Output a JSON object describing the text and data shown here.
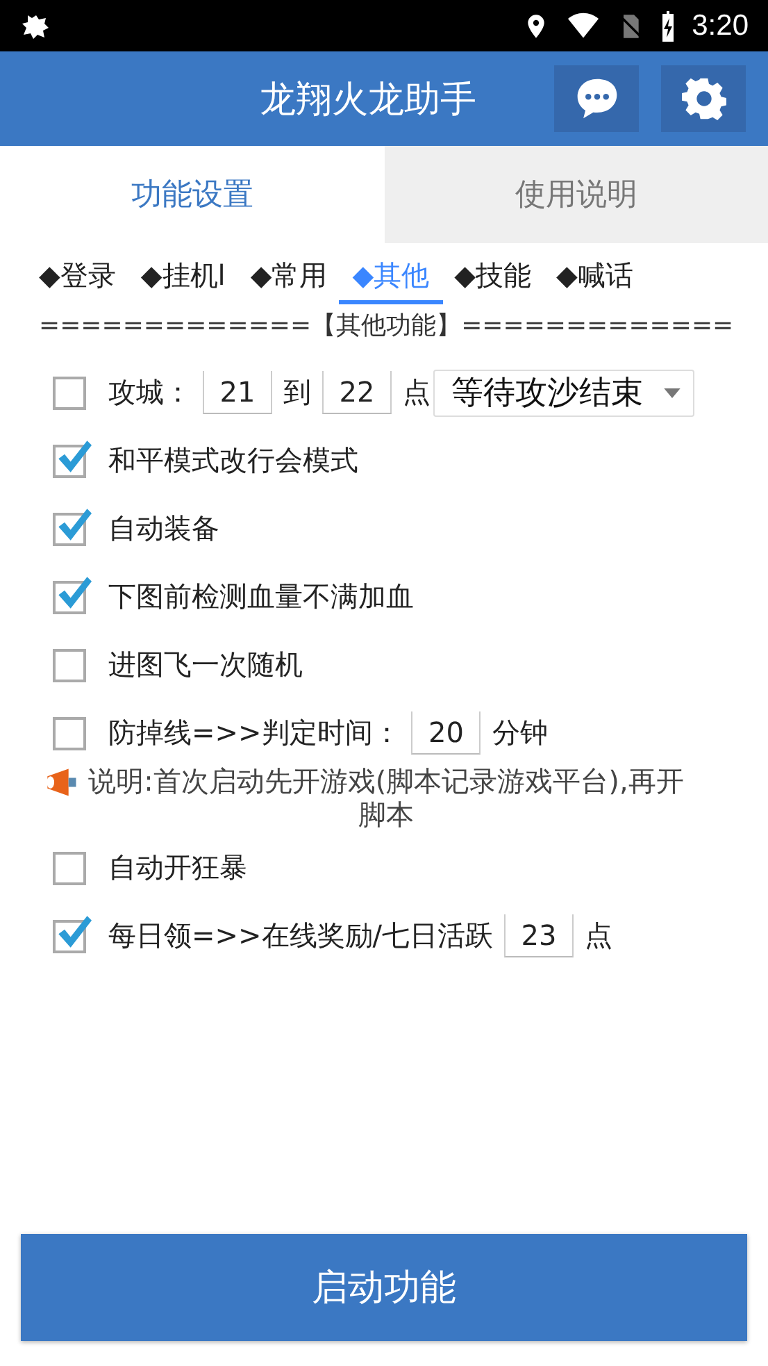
{
  "status_bar": {
    "time": "3:20"
  },
  "header": {
    "title": "龙翔火龙助手"
  },
  "tabs": [
    {
      "label": "功能设置",
      "selected": true
    },
    {
      "label": "使用说明",
      "selected": false
    }
  ],
  "sub_tabs": [
    {
      "label": "◆登录",
      "selected": false
    },
    {
      "label": "◆挂机l",
      "selected": false
    },
    {
      "label": "◆常用",
      "selected": false
    },
    {
      "label": "◆其他",
      "selected": true
    },
    {
      "label": "◆技能",
      "selected": false
    },
    {
      "label": "◆喊话",
      "selected": false
    }
  ],
  "section_title": "=============【其他功能】=============",
  "options": [
    {
      "kind": "check",
      "checked": false,
      "parts": [
        {
          "kind": "text",
          "text": "攻城："
        },
        {
          "kind": "input",
          "value": "21"
        },
        {
          "kind": "text",
          "text": "到"
        },
        {
          "kind": "input",
          "value": "22"
        },
        {
          "kind": "text",
          "text": "点"
        },
        {
          "kind": "dropdown",
          "value": "等待攻沙结束"
        }
      ]
    },
    {
      "kind": "check",
      "checked": true,
      "parts": [
        {
          "kind": "text",
          "text": "和平模式改行会模式"
        }
      ]
    },
    {
      "kind": "check",
      "checked": true,
      "parts": [
        {
          "kind": "text",
          "text": "自动装备"
        }
      ]
    },
    {
      "kind": "check",
      "checked": true,
      "parts": [
        {
          "kind": "text",
          "text": "下图前检测血量不满加血"
        }
      ]
    },
    {
      "kind": "check",
      "checked": false,
      "parts": [
        {
          "kind": "text",
          "text": "进图飞一次随机"
        }
      ]
    },
    {
      "kind": "check",
      "checked": false,
      "parts": [
        {
          "kind": "text",
          "text": "防掉线=>>判定时间："
        },
        {
          "kind": "input",
          "value": "20"
        },
        {
          "kind": "text",
          "text": "分钟"
        }
      ]
    },
    {
      "kind": "note",
      "text": "说明:首次启动先开游戏(脚本记录游戏平台),再开脚本"
    },
    {
      "kind": "check",
      "checked": false,
      "parts": [
        {
          "kind": "text",
          "text": "自动开狂暴"
        }
      ]
    },
    {
      "kind": "check",
      "checked": true,
      "parts": [
        {
          "kind": "text",
          "text": "每日领=>>在线奖励/七日活跃"
        },
        {
          "kind": "input",
          "value": "23"
        },
        {
          "kind": "text",
          "text": "点"
        }
      ]
    }
  ],
  "start_button": "启动功能"
}
